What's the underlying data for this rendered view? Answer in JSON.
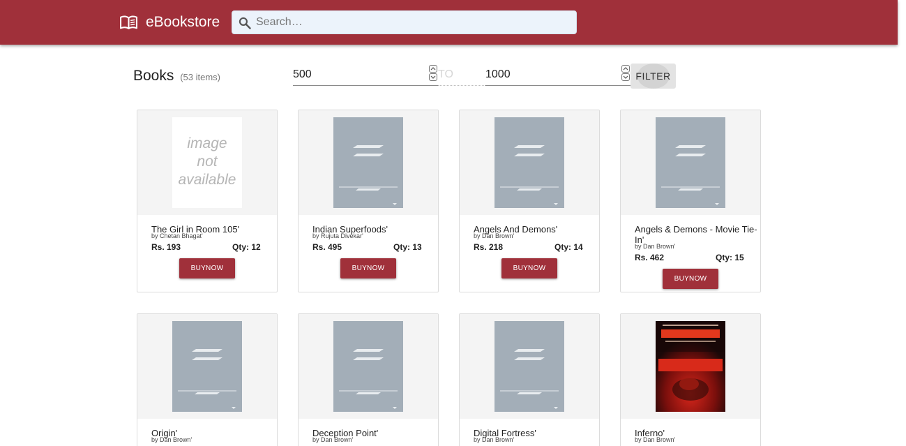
{
  "header": {
    "brand": "eBookstore",
    "search_placeholder": "Search…",
    "bar_color": "#a0303a"
  },
  "toolbar": {
    "heading": "Books",
    "count": "(53 items)",
    "min_price": "500",
    "to_label": "TO",
    "max_price": "1000",
    "filter_label": "FILTER"
  },
  "books": [
    {
      "title": "The Girl in Room 105'",
      "author": "by Chetan Bhagat'",
      "price": "Rs. 193",
      "qty": "Qty: 12",
      "buy_label": "BUYNOW",
      "cover": "image not available",
      "cover_text": [
        "image",
        "not",
        "available"
      ]
    },
    {
      "title": "Indian Superfoods'",
      "author": "by Rujuta Divekar'",
      "price": "Rs. 495",
      "qty": "Qty: 13",
      "buy_label": "BUYNOW",
      "cover": "placeholder"
    },
    {
      "title": "Angels And Demons'",
      "author": "by Dan Brown'",
      "price": "Rs. 218",
      "qty": "Qty: 14",
      "buy_label": "BUYNOW",
      "cover": "placeholder"
    },
    {
      "title": "Angels & Demons - Movie Tie-In'",
      "author": "by Dan Brown'",
      "price": "Rs. 462",
      "qty": "Qty: 15",
      "buy_label": "BUYNOW",
      "cover": "placeholder"
    },
    {
      "title": "Origin'",
      "author": "by Dan Brown'",
      "cover": "placeholder"
    },
    {
      "title": "Deception Point'",
      "author": "by Dan Brown'",
      "cover": "placeholder"
    },
    {
      "title": "Digital Fortress'",
      "author": "by Dan Brown'",
      "cover": "placeholder"
    },
    {
      "title": "Inferno'",
      "author": "by Dan Brown'",
      "cover": "inferno"
    }
  ],
  "colors": {
    "accent": "#a0303a",
    "placeholder_cover": "#a3aeb8"
  },
  "icons": {
    "brand": "open-book-icon",
    "search": "magnifier-icon"
  }
}
